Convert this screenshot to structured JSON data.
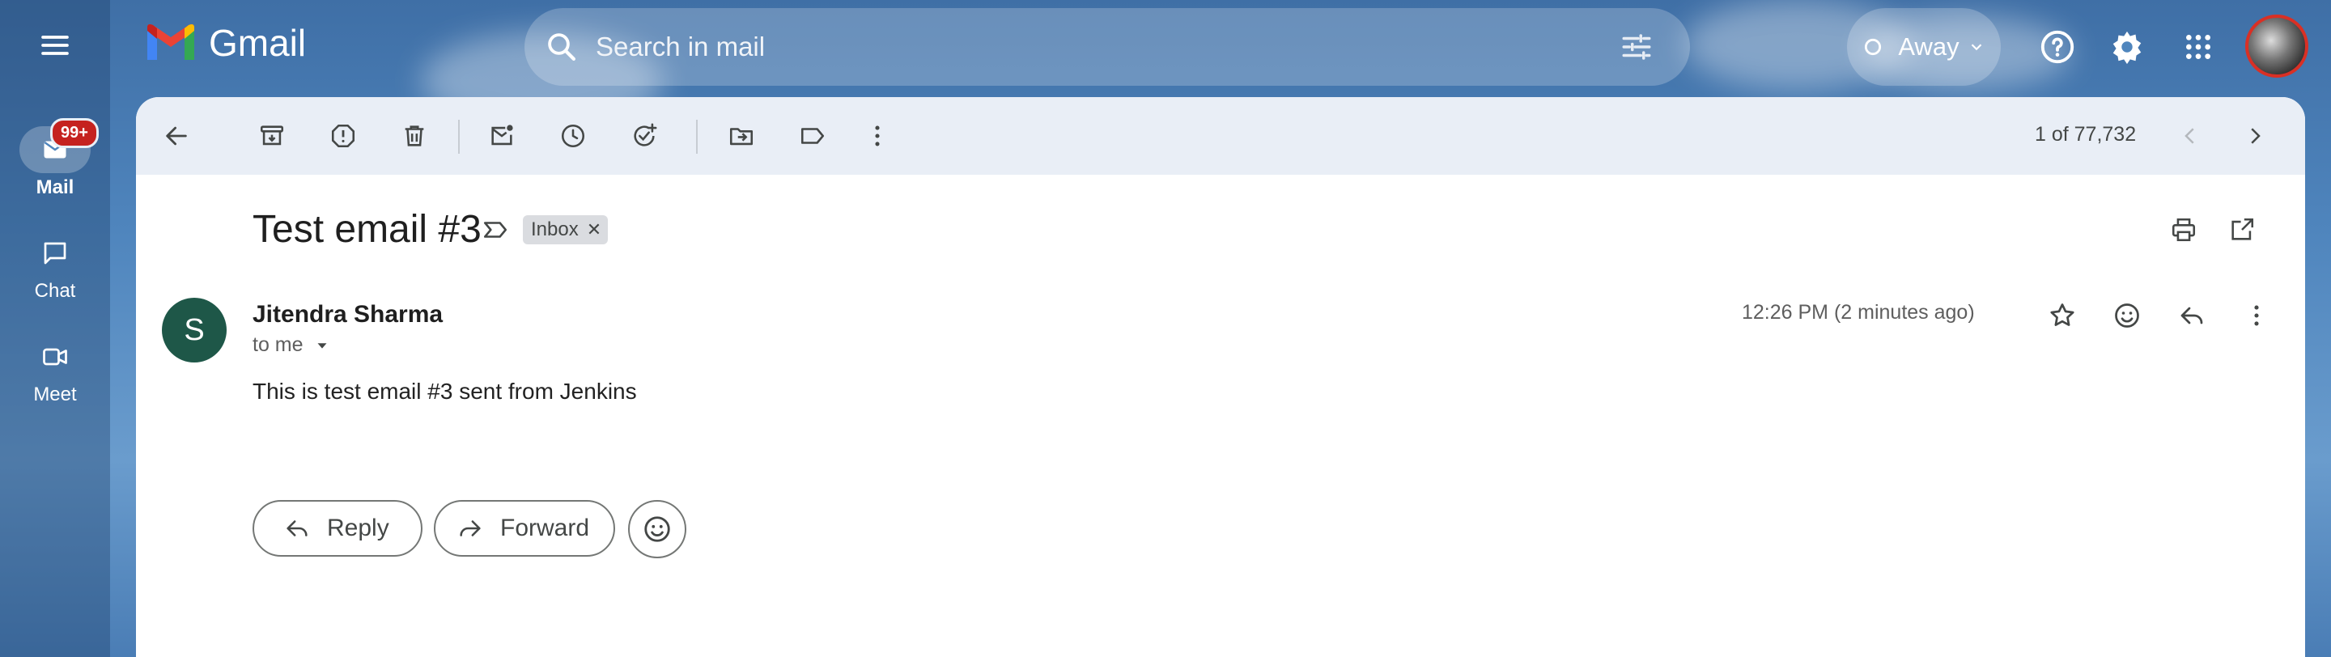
{
  "app": {
    "name": "Gmail"
  },
  "nav": {
    "badge": "99+",
    "items": [
      {
        "label": "Mail",
        "icon": "mail-icon",
        "active": true
      },
      {
        "label": "Chat",
        "icon": "chat-icon",
        "active": false
      },
      {
        "label": "Meet",
        "icon": "video-icon",
        "active": false
      }
    ]
  },
  "search": {
    "placeholder": "Search in mail"
  },
  "status": {
    "label": "Away"
  },
  "toolbar": {
    "count": "1 of 77,732"
  },
  "email": {
    "subject": "Test email #3",
    "label": "Inbox",
    "sender_initial": "S",
    "sender": "Jitendra Sharma",
    "recipient": "to me",
    "timestamp": "12:26 PM (2 minutes ago)",
    "body": "This is test email #3 sent from Jenkins"
  },
  "actions": {
    "reply": "Reply",
    "forward": "Forward"
  },
  "colors": {
    "accent": "#0b57d0",
    "badge": "#c5221f",
    "avatar": "#1e5748",
    "toolbar": "#e9eef6"
  }
}
